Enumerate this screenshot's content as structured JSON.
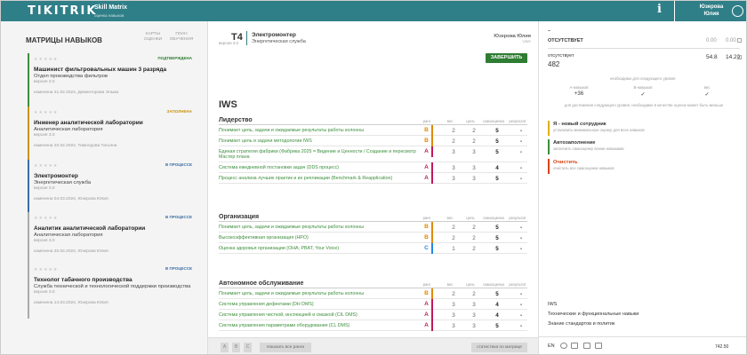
{
  "header": {
    "logo": "TIKITRIK",
    "app_name": "Skill Matrix",
    "app_sub": "оценка навыков",
    "info": "i",
    "user_last": "Юзерова",
    "user_first": "Юлия"
  },
  "left": {
    "title": "МАТРИЦЫ НАВЫКОВ",
    "nav_cards": "КАРТЫ ОЦЕНКИ",
    "nav_plan": "ПЛАН ОБУЧЕНИЯ",
    "cards": [
      {
        "status": "ПОДТВЕРЖДЕНА",
        "status_color": "#2e7d32",
        "accent": "#3c8f3c",
        "title": "Машинист фильтровальных машин 3 разряда",
        "dept": "Отдел производства фильтров",
        "version": "версия 3.0",
        "meta": "изменена 21.02.2024, Дементорова Эльма"
      },
      {
        "status": "ЗАПОЛНЕНА",
        "status_color": "#c8950f",
        "accent": "#c8950f",
        "title": "Инженер аналитической лаборатории",
        "dept": "Аналитическая лаборатория",
        "version": "версия 3.0",
        "meta": "изменена 20.02.2024, Тимолдова Татьяна"
      },
      {
        "status": "В ПРОЦЕССЕ",
        "status_color": "#3a6ea5",
        "accent": "#3a6ea5",
        "title": "Электромонтер",
        "dept": "Энергетическая служба",
        "version": "версия 3.0",
        "meta": "изменена 04.03.2024, Юзерова Юлия"
      },
      {
        "status": "В ПРОЦЕССЕ",
        "status_color": "#3a6ea5",
        "accent": "#aaaaaa",
        "title": "Аналитик аналитической лаборатории",
        "dept": "Аналитическая лаборатория",
        "version": "версия 3.0",
        "meta": "изменена 20.02.2024, Юзерова Юлия"
      },
      {
        "status": "В ПРОЦЕССЕ",
        "status_color": "#3a6ea5",
        "accent": "#aaaaaa",
        "title": "Технолог табачного производства",
        "dept": "Служба технической и технологической поддержки производства",
        "version": "версия 3.0",
        "meta": "изменена 14.03.2024, Юзерова Юлия"
      }
    ]
  },
  "main": {
    "code": "T4",
    "version": "версия 3.0",
    "title": "Электромонтер",
    "subtitle": "Энергетическая служба",
    "user": "Юзерова Юлия",
    "user_role": "User",
    "finish": "ЗАВЕРШИТЬ",
    "section_title": "IWS",
    "columns": {
      "rank": "ранг",
      "weight": "вес",
      "goal": "цель",
      "self": "самооценка",
      "result": "результат"
    },
    "groups": [
      {
        "name": "Лидерство",
        "rows": [
          {
            "name": "Понимает цель, задачи и ожидаемые результаты работы колонны",
            "rank": "B",
            "w": "2",
            "g": "2",
            "s": "5",
            "r": "-"
          },
          {
            "name": "Понимает цель и задачи методологии IWS",
            "rank": "B",
            "w": "2",
            "g": "2",
            "s": "5",
            "r": "-"
          },
          {
            "name": "Единая стратегия фабрики (Фабрика 2025 = Видение и Ценности / Создание и пересмотр Мастер плана",
            "rank": "A",
            "w": "3",
            "g": "3",
            "s": "5",
            "r": "-"
          },
          {
            "name": "Система ежедневной постановки задач (DDS процесс)",
            "rank": "A",
            "w": "3",
            "g": "3",
            "s": "4",
            "r": "-"
          },
          {
            "name": "Процесс анализа лучших практик и их репликации (Benchmark & Reapplication)",
            "rank": "A",
            "w": "3",
            "g": "3",
            "s": "5",
            "r": "-"
          }
        ]
      },
      {
        "name": "Организация",
        "rows": [
          {
            "name": "Понимает цель, задачи и ожидаемые результаты работы колонны",
            "rank": "B",
            "w": "2",
            "g": "2",
            "s": "5",
            "r": "-"
          },
          {
            "name": "Высокоэффективная организация (HPO)",
            "rank": "B",
            "w": "2",
            "g": "2",
            "s": "5",
            "r": "-"
          },
          {
            "name": "Оценка здоровья организации (OHA; PBAT, Your Voice)",
            "rank": "C",
            "w": "1",
            "g": "2",
            "s": "5",
            "r": "-"
          }
        ]
      },
      {
        "name": "Автономное обслуживание",
        "rows": [
          {
            "name": "Понимает цель, задачи и ожидаемые результаты работы колонны",
            "rank": "B",
            "w": "2",
            "g": "2",
            "s": "5",
            "r": "-"
          },
          {
            "name": "Система управления дефектами (DH DMS)",
            "rank": "A",
            "w": "3",
            "g": "3",
            "s": "4",
            "r": "-"
          },
          {
            "name": "Система управления чисткой, инспекцией и смазкой (CIL DMS)",
            "rank": "A",
            "w": "3",
            "g": "3",
            "s": "4",
            "r": "-"
          },
          {
            "name": "Система управления параметрами оборудования (CL DMS)",
            "rank": "A",
            "w": "3",
            "g": "3",
            "s": "5",
            "r": "-"
          }
        ]
      }
    ],
    "footer": {
      "b1": "A",
      "b2": "B",
      "b3": "C",
      "show_all": "показать все ранги",
      "stats": "статистика по матрице"
    }
  },
  "rank_colors": {
    "A": "#c2185b",
    "B": "#e08a00",
    "C": "#1e88e5"
  },
  "right": {
    "dash": "–",
    "absent1_label": "ОТСУТСТВУЕТ",
    "absent1_v1": "0.00",
    "absent1_v2": "0.00",
    "absent2_label": "отсутствует",
    "absent2_num": "482",
    "absent2_v1": "54.8",
    "absent2_v2": "14.29",
    "next_level": "необходимо для следующего уровня",
    "stats": [
      {
        "label": "A-навыков",
        "value": "+36"
      },
      {
        "label": "B-навыков",
        "value": "✓"
      },
      {
        "label": "вес",
        "value": "✓"
      }
    ],
    "note": "для достижения следующего уровня, необходимо в качестве оценок может быть меньше",
    "actions": [
      {
        "title": "Я - новый сотрудник",
        "desc": "установить минимальную оценку для всех навыков",
        "color": "#e0b000"
      },
      {
        "title": "Автозаполнение",
        "desc": "заполнить самооценку всеми навыками",
        "color": "#3c8f3c"
      },
      {
        "title": "Очистить",
        "desc": "очистить все самооценки навыков",
        "color": "#d84315"
      }
    ],
    "links": [
      "IWS",
      "Технические и функциональные навыки",
      "Знание стандартов и политик"
    ],
    "lang": "EN",
    "total": "742.50"
  }
}
